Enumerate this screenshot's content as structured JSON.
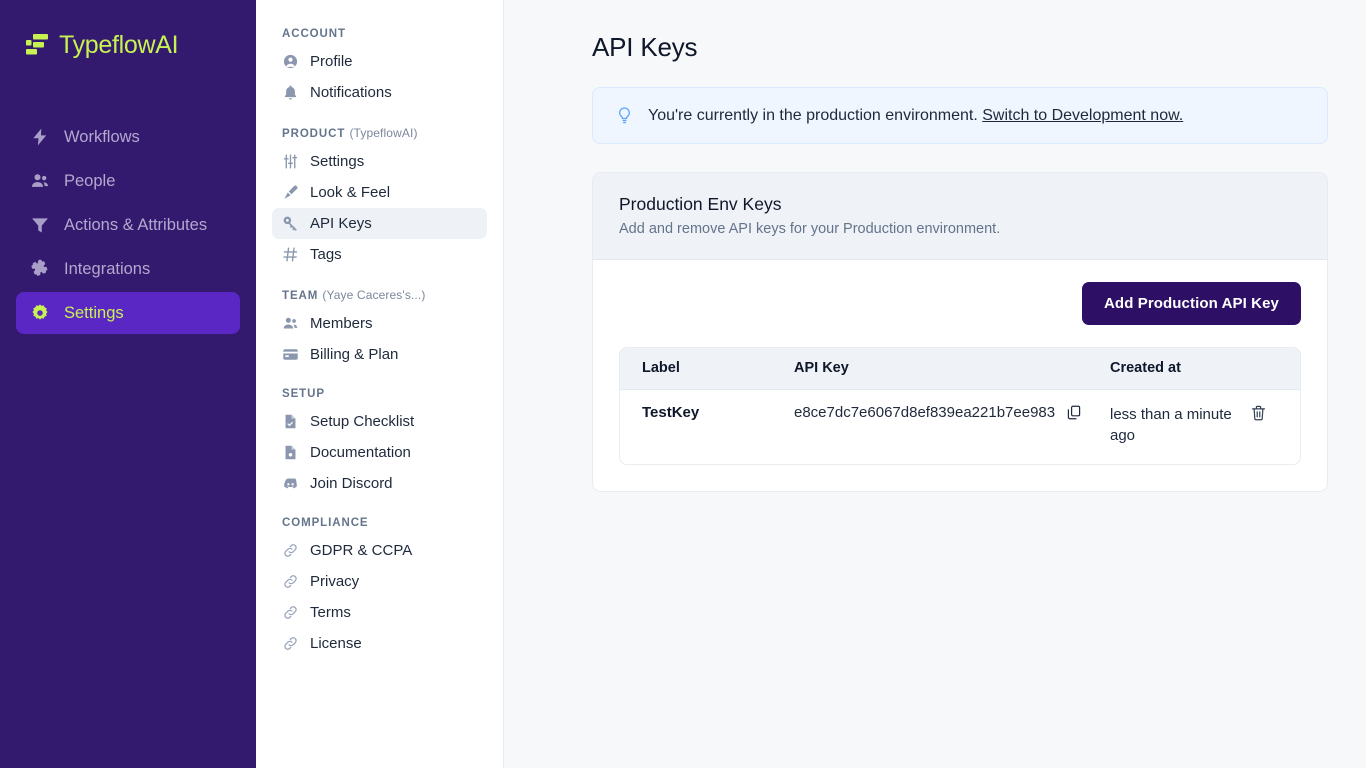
{
  "brand": {
    "name": "TypeflowAI",
    "logo_icon": "typeflow-bars-logo",
    "accent": "#c7f252",
    "bg": "#341a6e"
  },
  "primary_nav": {
    "items": [
      {
        "label": "Workflows",
        "icon": "lightning-bolt-icon",
        "active": false
      },
      {
        "label": "People",
        "icon": "people-icon",
        "active": false
      },
      {
        "label": "Actions & Attributes",
        "icon": "funnel-icon",
        "active": false
      },
      {
        "label": "Integrations",
        "icon": "puzzle-piece-icon",
        "active": false
      },
      {
        "label": "Settings",
        "icon": "gear-icon",
        "active": true
      }
    ],
    "active_bg": "#5b27c4"
  },
  "secondary_nav": {
    "groups": [
      {
        "heading": "ACCOUNT",
        "subheading": "",
        "items": [
          {
            "label": "Profile",
            "icon": "user-circle-icon",
            "active": false
          },
          {
            "label": "Notifications",
            "icon": "bell-icon",
            "active": false
          }
        ]
      },
      {
        "heading": "PRODUCT",
        "subheading": "(TypeflowAI)",
        "items": [
          {
            "label": "Settings",
            "icon": "sliders-icon",
            "active": false
          },
          {
            "label": "Look & Feel",
            "icon": "paintbrush-icon",
            "active": false
          },
          {
            "label": "API Keys",
            "icon": "key-icon",
            "active": true
          },
          {
            "label": "Tags",
            "icon": "hash-icon",
            "active": false
          }
        ]
      },
      {
        "heading": "TEAM",
        "subheading": "(Yaye Caceres's...)",
        "items": [
          {
            "label": "Members",
            "icon": "people-icon",
            "active": false
          },
          {
            "label": "Billing & Plan",
            "icon": "credit-card-icon",
            "active": false
          }
        ]
      },
      {
        "heading": "SETUP",
        "subheading": "",
        "items": [
          {
            "label": "Setup Checklist",
            "icon": "document-check-icon",
            "active": false
          },
          {
            "label": "Documentation",
            "icon": "document-icon",
            "active": false
          },
          {
            "label": "Join Discord",
            "icon": "discord-icon",
            "active": false
          }
        ]
      },
      {
        "heading": "COMPLIANCE",
        "subheading": "",
        "items": [
          {
            "label": "GDPR & CCPA",
            "icon": "link-icon",
            "active": false
          },
          {
            "label": "Privacy",
            "icon": "link-icon",
            "active": false
          },
          {
            "label": "Terms",
            "icon": "link-icon",
            "active": false
          },
          {
            "label": "License",
            "icon": "link-icon",
            "active": false
          }
        ]
      }
    ]
  },
  "main": {
    "page_title": "API Keys",
    "banner": {
      "icon": "lightbulb-icon",
      "text": "You're currently in the production environment.",
      "link_text": "Switch to Development now.",
      "bg": "#eff6ff",
      "border": "#dbeafe"
    },
    "card": {
      "title": "Production Env Keys",
      "subtitle": "Add and remove API keys for your Production environment.",
      "add_button_label": "Add Production API Key",
      "add_button_color": "#2d0f66"
    },
    "table": {
      "columns": [
        "Label",
        "API Key",
        "Created at"
      ],
      "rows": [
        {
          "label": "TestKey",
          "api_key": "e8ce7dc7e6067d8ef839ea221b7ee983",
          "created_at": "less than a minute ago",
          "copy_icon": "copy-icon",
          "delete_icon": "trash-icon"
        }
      ]
    }
  }
}
